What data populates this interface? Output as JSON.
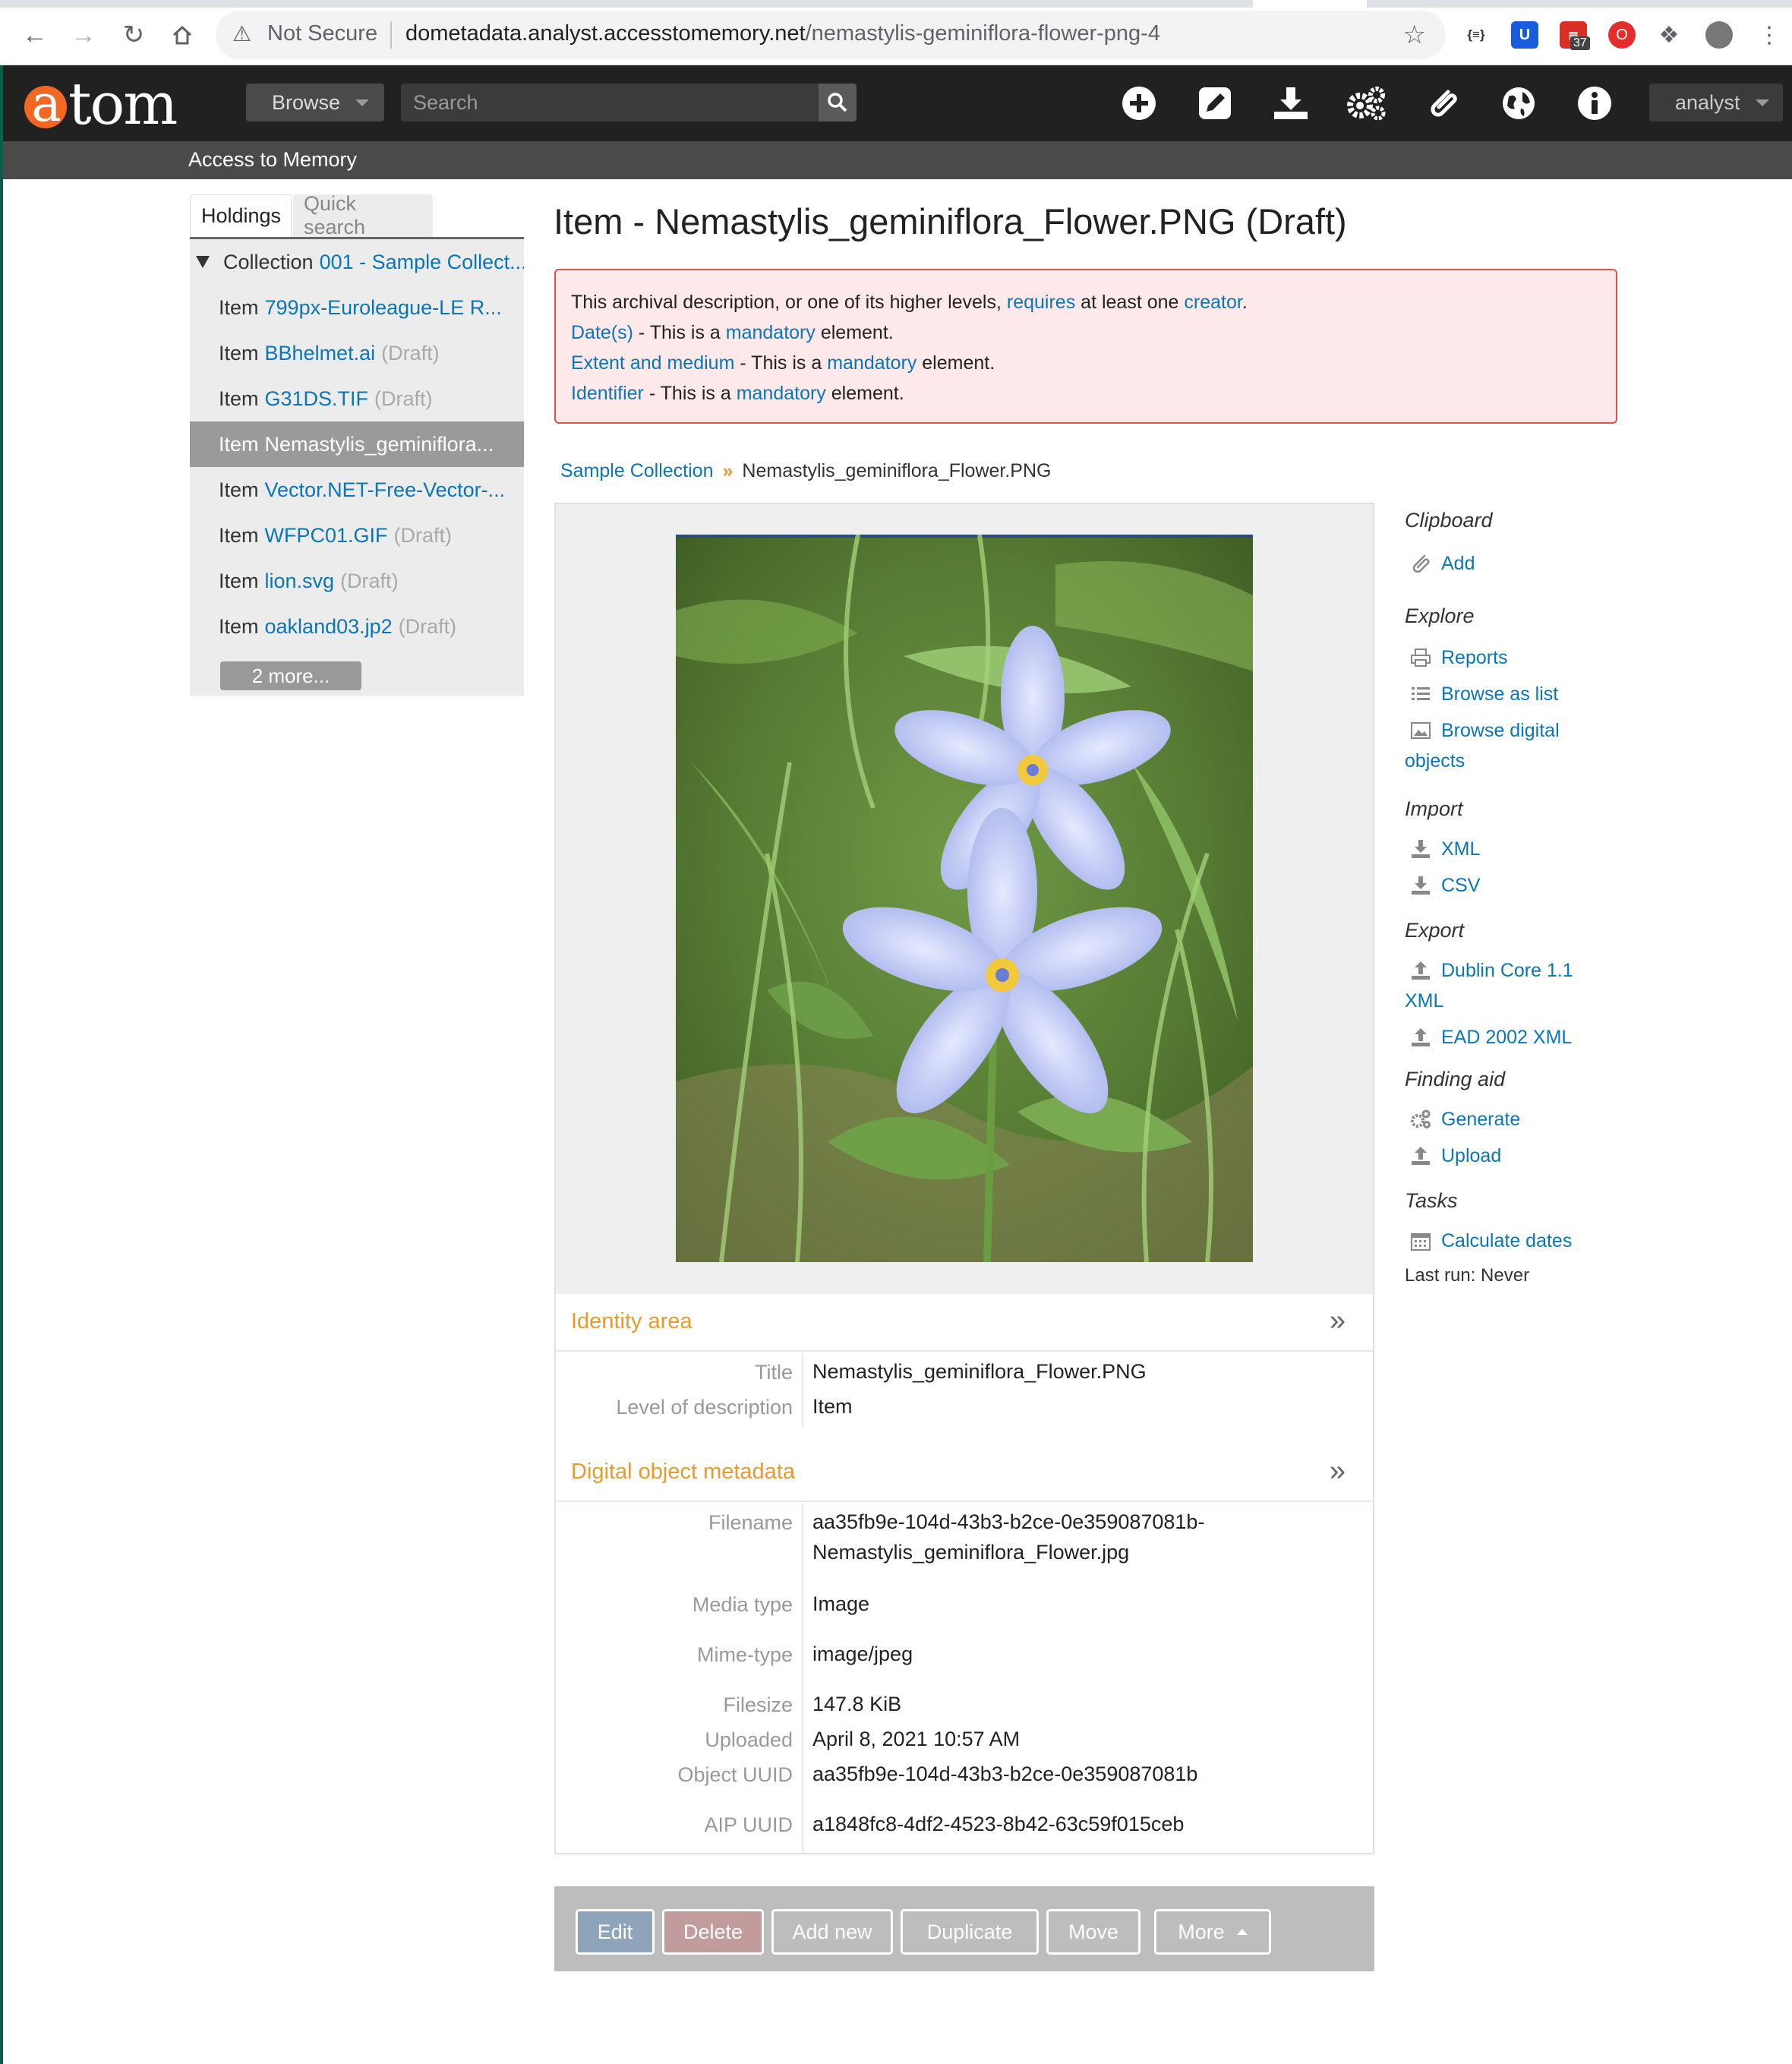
{
  "browser": {
    "security": "Not Secure",
    "url_host": "dometadata.analyst.accesstomemory.net",
    "url_path": "/nemastylis-geminiflora-flower-png-4",
    "ext_badge": "37"
  },
  "header": {
    "logo": "atom",
    "browse_label": "Browse",
    "search_placeholder": "Search",
    "user_label": "analyst",
    "site_name": "Access to Memory",
    "colors": {
      "bar": "#212121",
      "logo_accent": "#f26722",
      "link": "#0a76b5",
      "section": "#e89a2b"
    }
  },
  "sidebar": {
    "tabs": [
      "Holdings",
      "Quick search"
    ],
    "tree": [
      {
        "level": "Collection",
        "title": "001 - Sample Collect...",
        "draft": ""
      },
      {
        "level": "Item",
        "title": "799px-Euroleague-LE R...",
        "draft": ""
      },
      {
        "level": "Item",
        "title": "BBhelmet.ai",
        "draft": "(Draft)"
      },
      {
        "level": "Item",
        "title": "G31DS.TIF",
        "draft": "(Draft)"
      },
      {
        "level": "Item",
        "title": "Nemastylis_geminiflora...",
        "draft": ""
      },
      {
        "level": "Item",
        "title": "Vector.NET-Free-Vector-...",
        "draft": ""
      },
      {
        "level": "Item",
        "title": "WFPC01.GIF",
        "draft": "(Draft)"
      },
      {
        "level": "Item",
        "title": "lion.svg",
        "draft": "(Draft)"
      },
      {
        "level": "Item",
        "title": "oakland03.jp2",
        "draft": "(Draft)"
      }
    ],
    "more_label": "2 more..."
  },
  "main": {
    "title": "Item - Nemastylis_geminiflora_Flower.PNG (Draft)",
    "errors": {
      "line1_a": "This archival description, or one of its higher levels, ",
      "line1_link1": "requires",
      "line1_b": " at least one ",
      "line1_link2": "creator",
      "line1_c": ".",
      "line2_field": "Date(s)",
      "line2_mid": " - This is a ",
      "line2_link": "mandatory",
      "line2_end": " element.",
      "line3_field": "Extent and medium",
      "line3_mid": " - This is a ",
      "line3_link": "mandatory",
      "line3_end": " element.",
      "line4_field": "Identifier",
      "line4_mid": " - This is a ",
      "line4_link": "mandatory",
      "line4_end": " element."
    },
    "breadcrumb": {
      "parent": "Sample Collection",
      "current": "Nemastylis_geminiflora_Flower.PNG"
    },
    "identity": {
      "heading": "Identity area",
      "title_label": "Title",
      "title_value": "Nemastylis_geminiflora_Flower.PNG",
      "level_label": "Level of description",
      "level_value": "Item"
    },
    "digital": {
      "heading": "Digital object metadata",
      "filename_label": "Filename",
      "filename_line1": "aa35fb9e-104d-43b3-b2ce-0e359087081b-",
      "filename_line2": "Nemastylis_geminiflora_Flower.jpg",
      "media_label": "Media type",
      "media_value": "Image",
      "mime_label": "Mime-type",
      "mime_value": "image/jpeg",
      "size_label": "Filesize",
      "size_value": "147.8 KiB",
      "uploaded_label": "Uploaded",
      "uploaded_value": "April 8, 2021 10:57 AM",
      "uuid_label": "Object UUID",
      "uuid_value": "aa35fb9e-104d-43b3-b2ce-0e359087081b",
      "aip_label": "AIP UUID",
      "aip_value": "a1848fc8-4df2-4523-8b42-63c59f015ceb"
    },
    "actions": {
      "edit": "Edit",
      "delete": "Delete",
      "add_new": "Add new",
      "duplicate": "Duplicate",
      "move": "Move",
      "more": "More"
    }
  },
  "right_sidebar": {
    "clipboard": "Clipboard",
    "add": "Add",
    "explore": "Explore",
    "reports": "Reports",
    "browse_list": "Browse as list",
    "browse_digital_1": "Browse digital",
    "browse_digital_2": "objects",
    "import": "Import",
    "xml": "XML",
    "csv": "CSV",
    "export": "Export",
    "dc_1": "Dublin Core 1.1",
    "dc_2": "XML",
    "ead": "EAD 2002 XML",
    "finding_aid": "Finding aid",
    "generate": "Generate",
    "upload": "Upload",
    "tasks": "Tasks",
    "calc_dates": "Calculate dates",
    "last_run": "Last run: Never"
  }
}
